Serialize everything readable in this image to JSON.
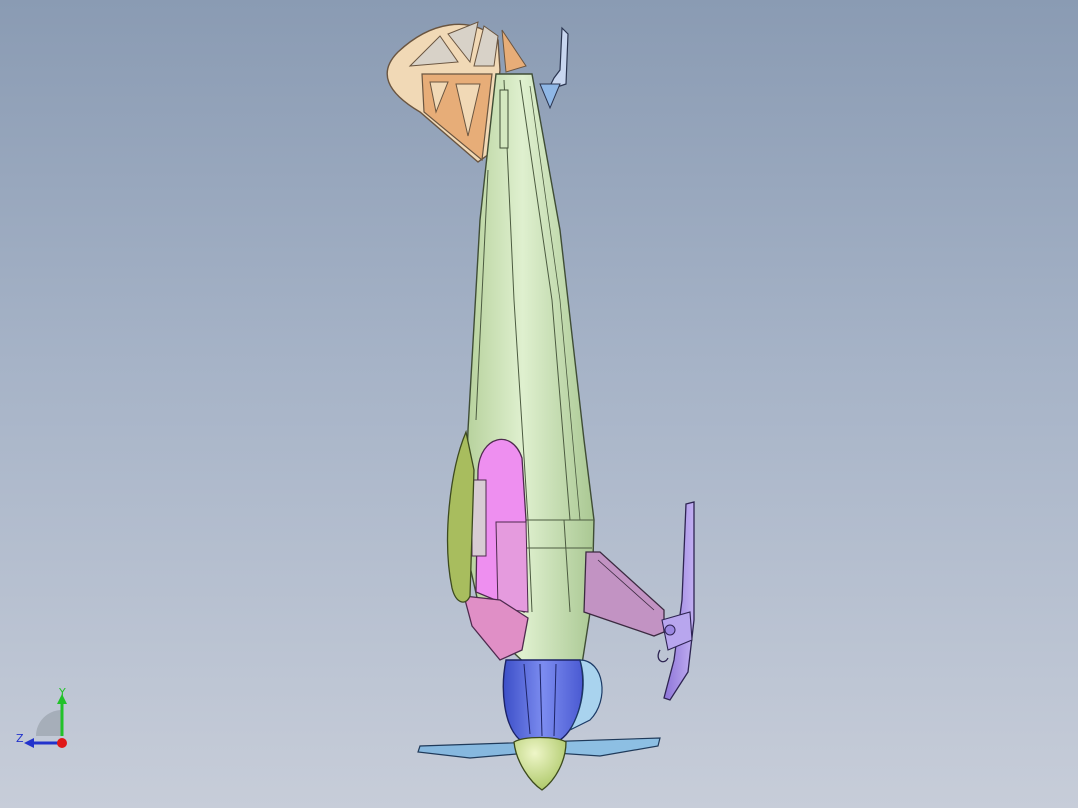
{
  "viewport": {
    "background_top": "#8a9bb3",
    "background_bottom": "#c7cdd9",
    "model": "aircraft-3d-model"
  },
  "triad": {
    "y_label": "Y",
    "z_label": "Z",
    "y_color": "#22c22a",
    "z_color": "#2233cc",
    "x_color": "#e01818"
  },
  "colors": {
    "fuselage": "#c9e0b4",
    "tail_frame": "#e4b07a",
    "side_panel": "#ea8fe8",
    "cowling": "#5b6ee0",
    "spinner": "#c6dc8a",
    "wing": "#c394c4",
    "landing_gear": "#a58ae6",
    "wheel_fairing": "#a6b95a",
    "propeller": "#7fb2dc"
  }
}
